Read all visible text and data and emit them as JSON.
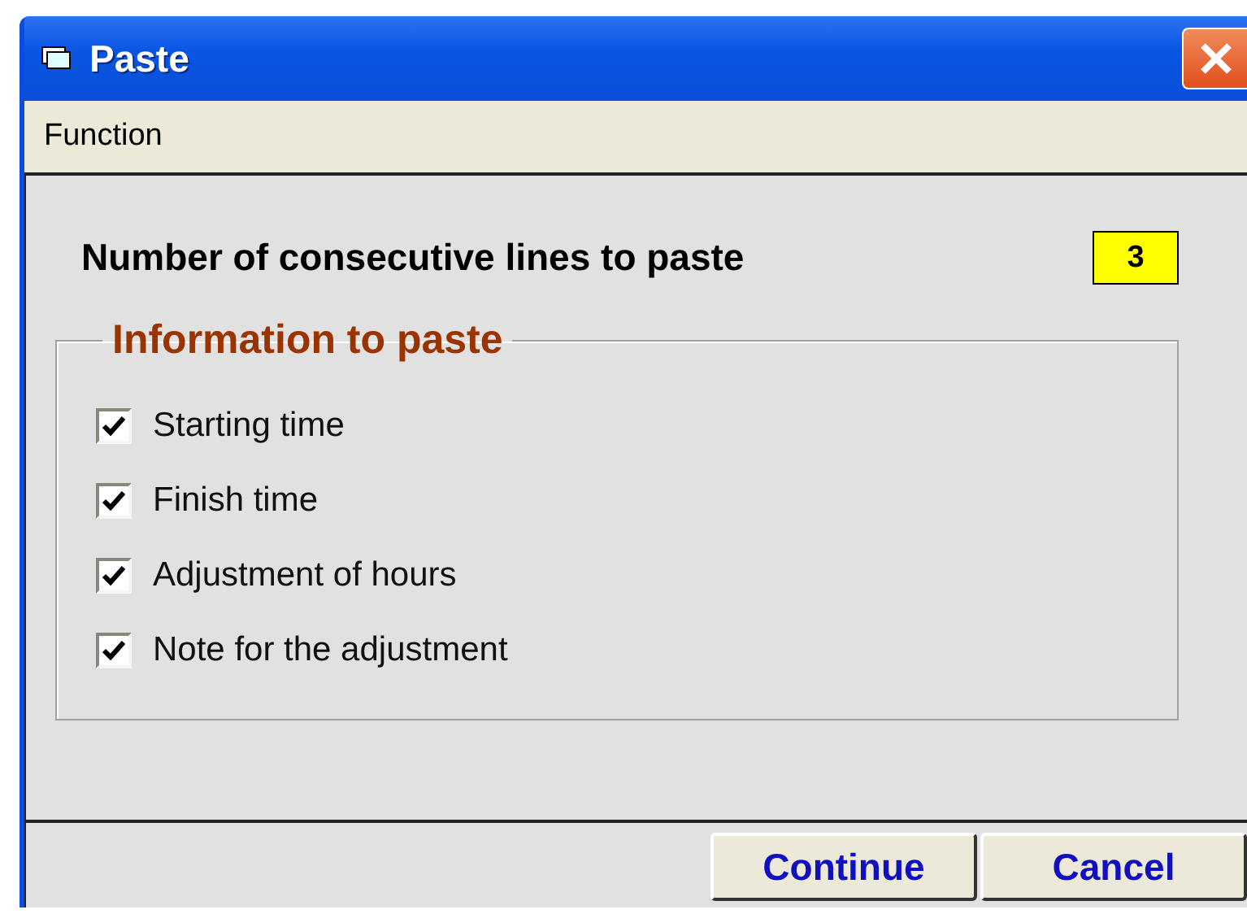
{
  "window": {
    "title": "Paste"
  },
  "menu": [
    "Function"
  ],
  "count": {
    "label": "Number of consecutive lines to paste",
    "value": "3"
  },
  "group": {
    "title": "Information to paste",
    "options": [
      {
        "label": "Starting time",
        "checked": true
      },
      {
        "label": "Finish time",
        "checked": true
      },
      {
        "label": "Adjustment of hours",
        "checked": true
      },
      {
        "label": "Note for the adjustment",
        "checked": true
      }
    ]
  },
  "buttons": [
    "Continue",
    "Cancel"
  ]
}
